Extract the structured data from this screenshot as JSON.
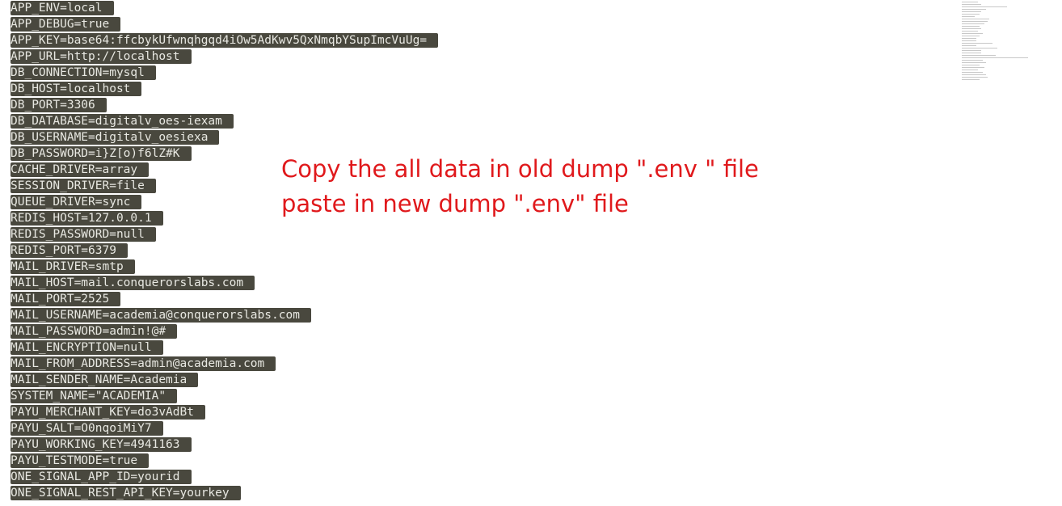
{
  "env_lines": [
    "APP_ENV=local",
    "APP_DEBUG=true",
    "APP_KEY=base64:ffcbykUfwnqhgqd4iOw5AdKwv5QxNmqbYSupImcVuUg=",
    "APP_URL=http://localhost",
    "DB_CONNECTION=mysql",
    "DB_HOST=localhost",
    "DB_PORT=3306",
    "DB_DATABASE=digitalv_oes-iexam",
    "DB_USERNAME=digitalv_oesiexa",
    "DB_PASSWORD=i}Z[o)f6lZ#K",
    "CACHE_DRIVER=array",
    "SESSION_DRIVER=file",
    "QUEUE_DRIVER=sync",
    "REDIS_HOST=127.0.0.1",
    "REDIS_PASSWORD=null",
    "REDIS_PORT=6379",
    "MAIL_DRIVER=smtp",
    "MAIL_HOST=mail.conquerorslabs.com",
    "MAIL_PORT=2525",
    "MAIL_USERNAME=academia@conquerorslabs.com",
    "MAIL_PASSWORD=admin!@#",
    "MAIL_ENCRYPTION=null",
    "MAIL_FROM_ADDRESS=admin@academia.com",
    "MAIL_SENDER_NAME=Academia",
    "SYSTEM_NAME=\"ACADEMIA\"",
    "PAYU_MERCHANT_KEY=do3vAdBt",
    "PAYU_SALT=O0nqoiMiY7",
    "PAYU_WORKING_KEY=4941163",
    "PAYU_TESTMODE=true",
    "ONE_SIGNAL_APP_ID=yourid",
    "ONE_SIGNAL_REST_API_KEY=yourkey"
  ],
  "annotation": {
    "line1": "Copy the all data in old dump \".env \" file",
    "line2": "paste in new dump \".env\" file"
  },
  "colors": {
    "selection": "#49483e",
    "code_text": "#e8e8e2",
    "annotation_text": "#e0191c"
  }
}
